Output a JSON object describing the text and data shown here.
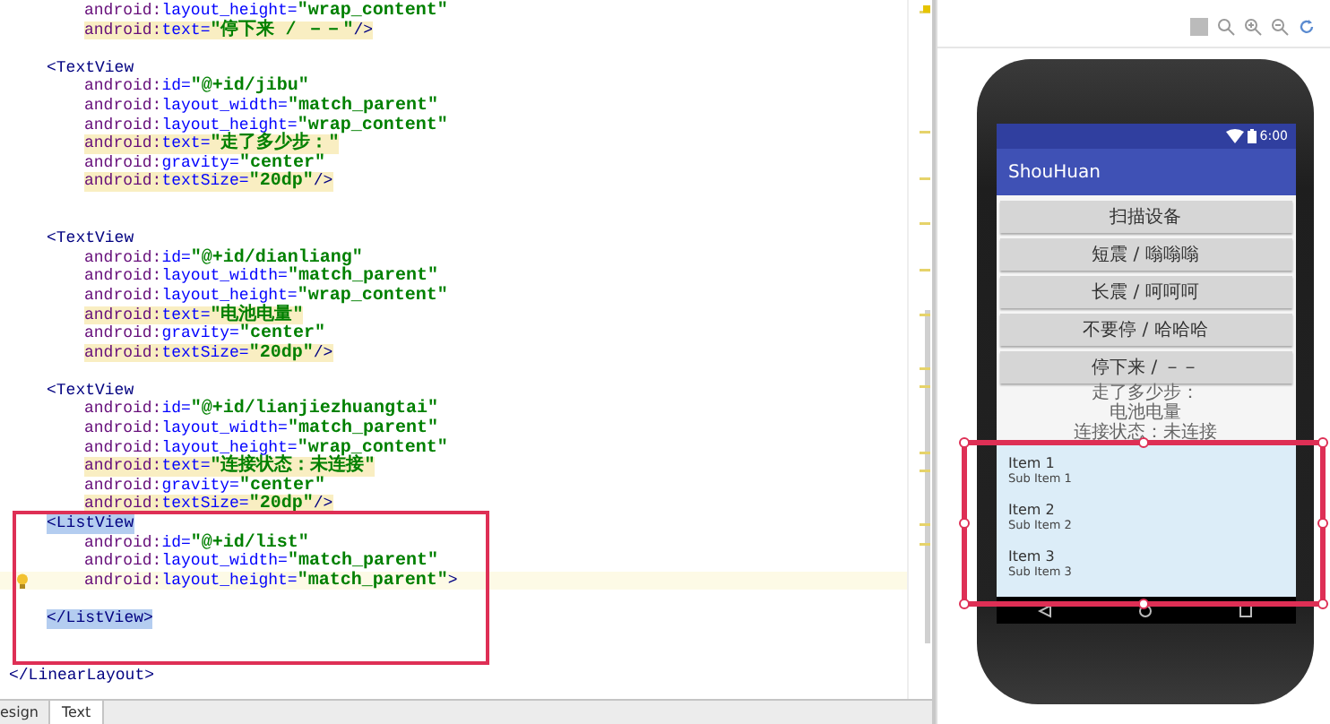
{
  "editor": {
    "lines": [
      {
        "kind": "attr",
        "ns": "android:",
        "name": "layout_height=",
        "value": "\"wrap_content\"",
        "highlighted": false
      },
      {
        "kind": "attr",
        "ns": "android:",
        "name": "text=",
        "value": "\"停下来 / －－\"",
        "end": "/>",
        "highlighted": true
      },
      {
        "kind": "blank"
      },
      {
        "kind": "tag",
        "text": "<TextView",
        "selected": false
      },
      {
        "kind": "attr",
        "ns": "android:",
        "name": "id=",
        "value": "\"@+id/jibu\"",
        "highlighted": false
      },
      {
        "kind": "attr",
        "ns": "android:",
        "name": "layout_width=",
        "value": "\"match_parent\"",
        "highlighted": false
      },
      {
        "kind": "attr",
        "ns": "android:",
        "name": "layout_height=",
        "value": "\"wrap_content\"",
        "highlighted": false
      },
      {
        "kind": "attr",
        "ns": "android:",
        "name": "text=",
        "value": "\"走了多少步：\"",
        "highlighted": true
      },
      {
        "kind": "attr",
        "ns": "android:",
        "name": "gravity=",
        "value": "\"center\"",
        "highlighted": false
      },
      {
        "kind": "attr",
        "ns": "android:",
        "name": "textSize=",
        "value": "\"20dp\"",
        "end": "/>",
        "highlighted": true
      },
      {
        "kind": "blank"
      },
      {
        "kind": "blank"
      },
      {
        "kind": "tag",
        "text": "<TextView",
        "selected": false
      },
      {
        "kind": "attr",
        "ns": "android:",
        "name": "id=",
        "value": "\"@+id/dianliang\"",
        "highlighted": false
      },
      {
        "kind": "attr",
        "ns": "android:",
        "name": "layout_width=",
        "value": "\"match_parent\"",
        "highlighted": false
      },
      {
        "kind": "attr",
        "ns": "android:",
        "name": "layout_height=",
        "value": "\"wrap_content\"",
        "highlighted": false
      },
      {
        "kind": "attr",
        "ns": "android:",
        "name": "text=",
        "value": "\"电池电量\"",
        "highlighted": true
      },
      {
        "kind": "attr",
        "ns": "android:",
        "name": "gravity=",
        "value": "\"center\"",
        "highlighted": false
      },
      {
        "kind": "attr",
        "ns": "android:",
        "name": "textSize=",
        "value": "\"20dp\"",
        "end": "/>",
        "highlighted": true
      },
      {
        "kind": "blank"
      },
      {
        "kind": "tag",
        "text": "<TextView",
        "selected": false
      },
      {
        "kind": "attr",
        "ns": "android:",
        "name": "id=",
        "value": "\"@+id/lianjiezhuangtai\"",
        "highlighted": false
      },
      {
        "kind": "attr",
        "ns": "android:",
        "name": "layout_width=",
        "value": "\"match_parent\"",
        "highlighted": false
      },
      {
        "kind": "attr",
        "ns": "android:",
        "name": "layout_height=",
        "value": "\"wrap_content\"",
        "highlighted": false
      },
      {
        "kind": "attr",
        "ns": "android:",
        "name": "text=",
        "value": "\"连接状态：未连接\"",
        "highlighted": true
      },
      {
        "kind": "attr",
        "ns": "android:",
        "name": "gravity=",
        "value": "\"center\"",
        "highlighted": false
      },
      {
        "kind": "attr",
        "ns": "android:",
        "name": "textSize=",
        "value": "\"20dp\"",
        "end": "/>",
        "highlighted": true
      },
      {
        "kind": "tag",
        "text": "<ListView",
        "selected": true
      },
      {
        "kind": "attr",
        "ns": "android:",
        "name": "id=",
        "value": "\"@+id/list\"",
        "highlighted": false
      },
      {
        "kind": "attr",
        "ns": "android:",
        "name": "layout_width=",
        "value": "\"match_parent\"",
        "highlighted": false
      },
      {
        "kind": "attr",
        "ns": "android:",
        "name": "layout_height=",
        "value": "\"match_parent\"",
        "end": ">",
        "highlighted": false,
        "current": true,
        "warning": true
      },
      {
        "kind": "blank"
      },
      {
        "kind": "tag",
        "text": "</ListView>",
        "selected": true
      },
      {
        "kind": "blank"
      },
      {
        "kind": "blank"
      },
      {
        "kind": "root",
        "text": "</LinearLayout>"
      }
    ]
  },
  "bottom_tabs": [
    {
      "label": "esign",
      "selected": false
    },
    {
      "label": "Text",
      "selected": true
    }
  ],
  "preview": {
    "status_time": "6:00",
    "app_title": "ShouHuan",
    "buttons": [
      "扫描设备",
      "短震 / 嗡嗡嗡",
      "长震 / 呵呵呵",
      "不要停 / 哈哈哈",
      "停下来 / －－"
    ],
    "texts": [
      "走了多少步：",
      "电池电量",
      "连接状态：未连接"
    ],
    "list_items": [
      {
        "title": "Item 1",
        "subtitle": "Sub Item 1"
      },
      {
        "title": "Item 2",
        "subtitle": "Sub Item 2"
      },
      {
        "title": "Item 3",
        "subtitle": "Sub Item 3"
      }
    ]
  }
}
